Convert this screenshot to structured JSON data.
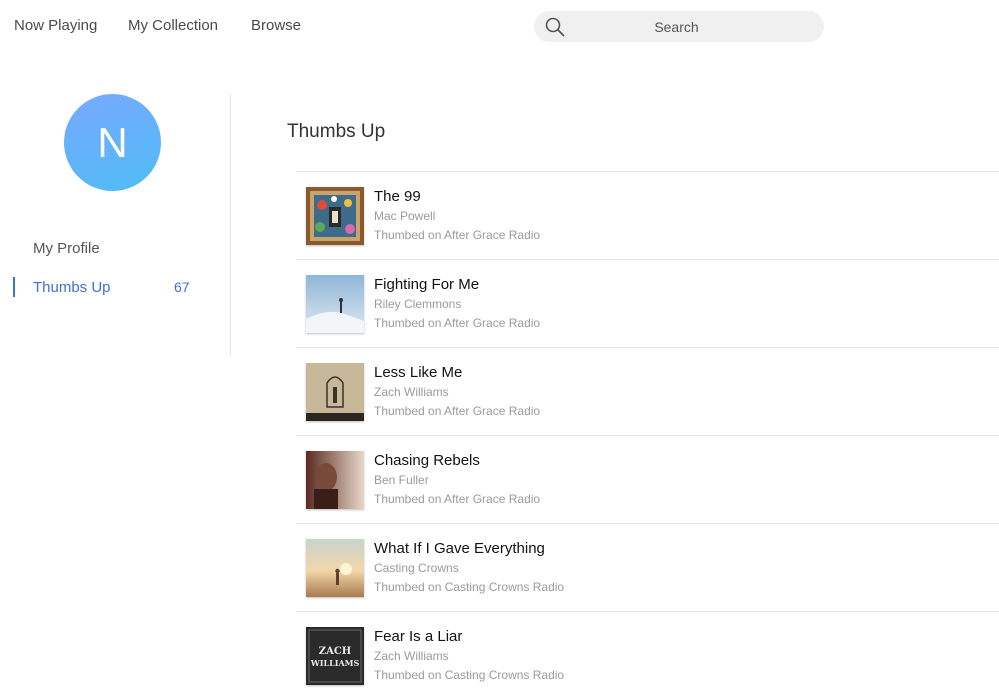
{
  "nav": {
    "now_playing": "Now Playing",
    "my_collection": "My Collection",
    "browse": "Browse"
  },
  "search": {
    "placeholder": "Search"
  },
  "profile": {
    "avatar_letter": "N"
  },
  "sidebar": {
    "my_profile": "My Profile",
    "thumbs_up": "Thumbs Up",
    "thumbs_up_count": "67"
  },
  "main": {
    "title": "Thumbs Up",
    "tracks": [
      {
        "title": "The 99",
        "artist": "Mac Powell",
        "source": "Thumbed on After Grace Radio"
      },
      {
        "title": "Fighting For Me",
        "artist": "Riley Clemmons",
        "source": "Thumbed on After Grace Radio"
      },
      {
        "title": "Less Like Me",
        "artist": "Zach Williams",
        "source": "Thumbed on After Grace Radio"
      },
      {
        "title": "Chasing Rebels",
        "artist": "Ben Fuller",
        "source": "Thumbed on After Grace Radio"
      },
      {
        "title": "What If I Gave Everything",
        "artist": "Casting Crowns",
        "source": "Thumbed on Casting Crowns Radio"
      },
      {
        "title": "Fear Is a Liar",
        "artist": "Zach Williams",
        "source": "Thumbed on Casting Crowns Radio",
        "art_text": [
          "ZACH",
          "WILLIAMS"
        ]
      }
    ]
  },
  "colors": {
    "accent": "#3f6fd8",
    "avatar_gradient_start": "#79a8ff",
    "avatar_gradient_end": "#4fbdf5",
    "search_background": "#f0f0f0"
  }
}
